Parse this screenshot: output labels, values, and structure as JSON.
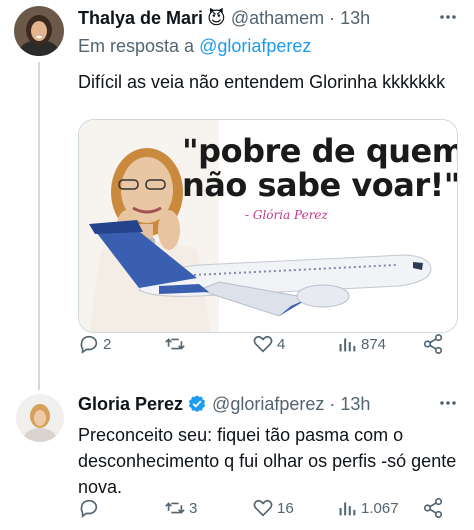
{
  "tweets": [
    {
      "author": {
        "name": "Thalya de Mari",
        "emoji": "😈",
        "handle": "@athamem"
      },
      "time": "13h",
      "reply_prefix": "Em resposta a",
      "reply_to": "@gloriafperez",
      "text": "Difícil as veia não entendem Glorinha kkkkkkk",
      "media": {
        "quote": "\"pobre de quem\nnão sabe voar!\"",
        "signature": "- Glória Perez"
      },
      "actions": {
        "replies": "2",
        "retweets": "",
        "likes": "4",
        "views": "874"
      }
    },
    {
      "author": {
        "name": "Gloria Perez",
        "handle": "@gloriafperez",
        "verified": true
      },
      "time": "13h",
      "text": "Preconceito seu: fiquei tão pasma com o desconhecimento q fui olhar os perfis -só gente nova.",
      "actions": {
        "replies": "",
        "retweets": "3",
        "likes": "16",
        "views": "1.067"
      }
    }
  ],
  "colors": {
    "accent": "#1d9bf0",
    "secondary_text": "#536471",
    "primary_text": "#0f1419",
    "divider": "#cfd9de"
  },
  "icons": [
    "more-icon",
    "reply-icon",
    "retweet-icon",
    "like-icon",
    "views-icon",
    "share-icon",
    "verified-icon"
  ]
}
